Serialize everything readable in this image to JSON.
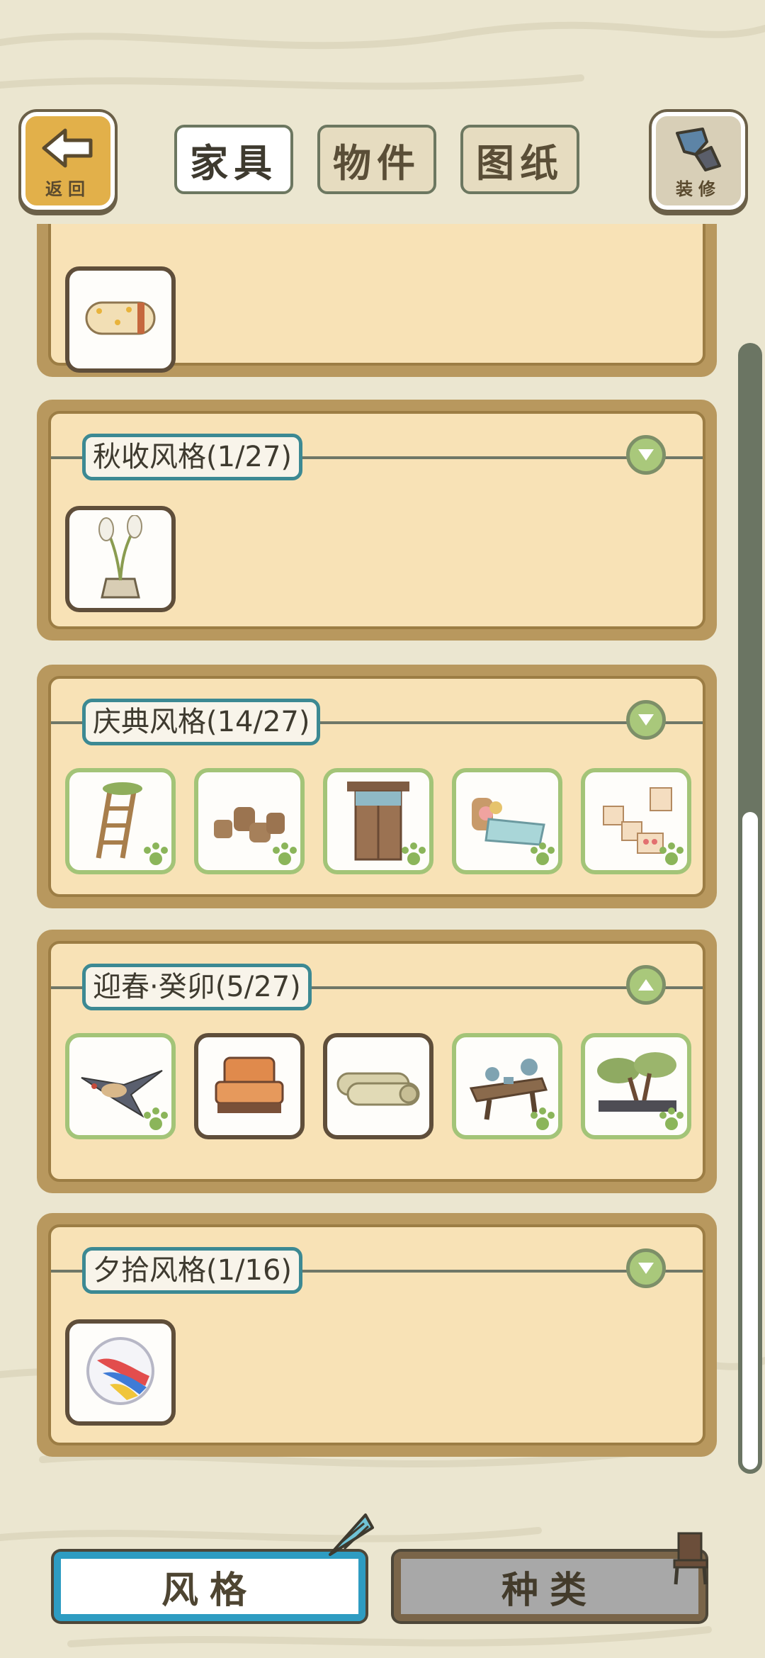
{
  "top_bar": {
    "back_label": "返回",
    "decorate_label": "装修",
    "tabs": [
      {
        "label": "家具",
        "active": true
      },
      {
        "label": "物件",
        "active": false
      },
      {
        "label": "图纸",
        "active": false
      }
    ]
  },
  "sections": [
    {
      "title": "",
      "items": [
        {
          "icon": "rolled-blanket-icon",
          "owned": false
        }
      ]
    },
    {
      "title": "秋收风格(1/27)",
      "expanded": false,
      "items": [
        {
          "icon": "pampas-grass-pot-icon",
          "owned": false
        }
      ]
    },
    {
      "title": "庆典风格(14/27)",
      "expanded": false,
      "items": [
        {
          "icon": "ladder-icon",
          "owned": true
        },
        {
          "icon": "clay-pots-icon",
          "owned": true
        },
        {
          "icon": "wooden-door-icon",
          "owned": true
        },
        {
          "icon": "bed-icon",
          "owned": true
        },
        {
          "icon": "memo-board-icon",
          "owned": true
        }
      ]
    },
    {
      "title": "迎春·癸卯(5/27)",
      "expanded": true,
      "items": [
        {
          "icon": "swallow-icon",
          "owned": true
        },
        {
          "icon": "armchair-icon",
          "owned": false
        },
        {
          "icon": "rolled-mats-icon",
          "owned": false
        },
        {
          "icon": "tea-table-icon",
          "owned": true
        },
        {
          "icon": "bonsai-icon",
          "owned": true
        }
      ]
    },
    {
      "title": "夕拾风格(1/16)",
      "expanded": false,
      "items": [
        {
          "icon": "marble-ball-icon",
          "owned": false
        }
      ]
    }
  ],
  "bottom_tabs": [
    {
      "label": "风格",
      "active": true
    },
    {
      "label": "种类",
      "active": false
    }
  ],
  "colors": {
    "background": "#ebe6d0",
    "panel_frame": "#b8985e",
    "panel_fill": "#f8e2b6",
    "label_border": "#3c8993",
    "owned_border": "#a3c478",
    "active_tab_border": "#2e9cc2"
  }
}
